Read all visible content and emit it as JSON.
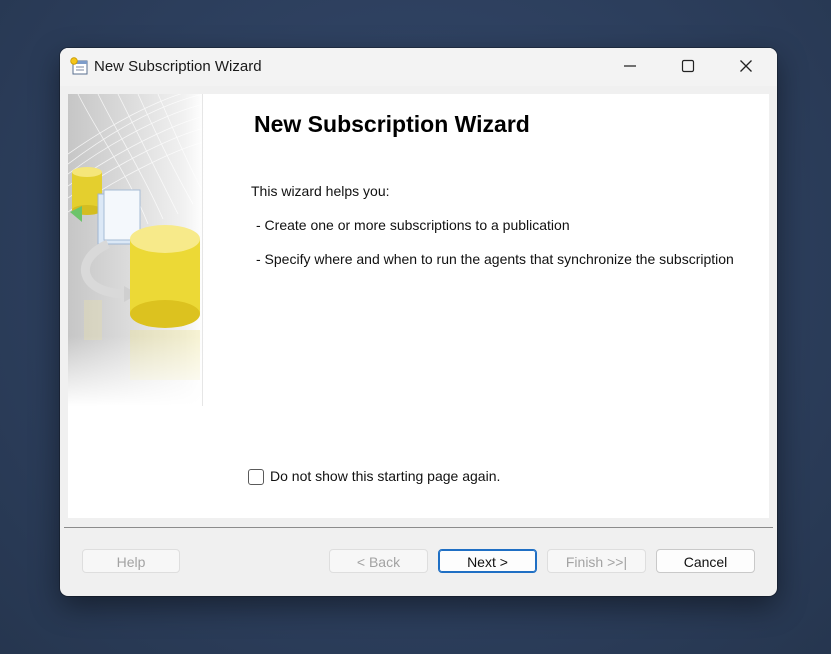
{
  "window": {
    "title": "New Subscription Wizard",
    "controls": {
      "minimize": "minimize-icon",
      "maximize": "maximize-icon",
      "close": "close-icon"
    }
  },
  "wizard": {
    "heading": "New Subscription Wizard",
    "intro": "This wizard helps you:",
    "bullets": [
      "- Create one or more subscriptions to a publication",
      "- Specify where and when to run the agents that synchronize the subscription"
    ],
    "checkbox": {
      "label": "Do not show this starting page again.",
      "checked": false
    }
  },
  "buttons": {
    "help": "Help",
    "back": "< Back",
    "next": "Next >",
    "finish": "Finish >>|",
    "cancel": "Cancel"
  },
  "colors": {
    "accent": "#1f6fc4",
    "cylinder": "#f2dc3a"
  }
}
